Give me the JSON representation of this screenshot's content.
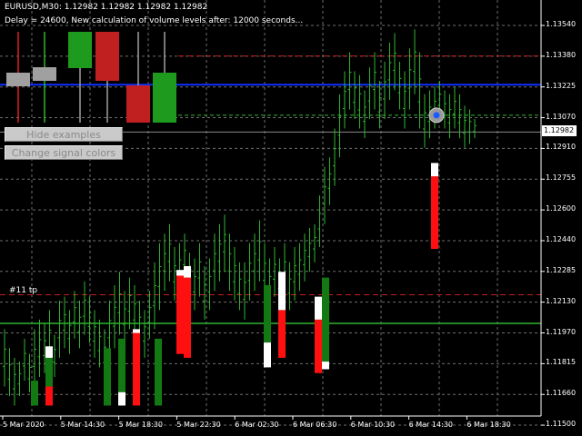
{
  "header": {
    "line1": "EURUSD,M30:  1.12982 1.12982 1.12982 1.12982",
    "line2": "Delay = 24600, New calculation of volume levels after: 12000 seconds..."
  },
  "buttons": {
    "hide_examples": "Hide examples",
    "change_signal_colors": "Change signal colors"
  },
  "current_price": "1.12982",
  "trade_label": "#11 tp",
  "price_axis": [
    "1.13540",
    "1.13380",
    "1.13225",
    "1.13070",
    "1.12910",
    "1.12755",
    "1.12600",
    "1.12440",
    "1.12285",
    "1.12130",
    "1.11970",
    "1.11815",
    "1.11660",
    "1.11500"
  ],
  "time_axis": [
    "5 Mar 2020",
    "5 Mar 14:30",
    "5 Mar 18:30",
    "5 Mar 22:30",
    "6 Mar 02:30",
    "6 Mar 06:30",
    "6 Mar 10:30",
    "6 Mar 14:30",
    "6 Mar 18:30"
  ],
  "colors": {
    "background": "#000000",
    "grid": "#6e6e6e",
    "bar": "#2fb52f",
    "buy_signal": "#137a13",
    "sell_signal": "#ff1010",
    "neutral": "#ffffff",
    "blue_line": "#1030ff",
    "tp_line": "#c81e1e",
    "green_level": "#2fb52f"
  },
  "chart_data": {
    "type": "bar",
    "symbol": "EURUSD",
    "timeframe": "M30",
    "ylim": [
      1.115,
      1.1354
    ],
    "levels": {
      "blue": 1.1323,
      "tp_top": 1.1338,
      "tp_bottom": 1.1213,
      "green_dashed": 1.1307,
      "green_solid": 1.1198,
      "current": 1.12982
    },
    "bars": [
      [
        1.1165,
        1.1195
      ],
      [
        1.116,
        1.1185
      ],
      [
        1.1155,
        1.118
      ],
      [
        1.116,
        1.1178
      ],
      [
        1.1168,
        1.119
      ],
      [
        1.1162,
        1.1182
      ],
      [
        1.1165,
        1.1195
      ],
      [
        1.117,
        1.12
      ],
      [
        1.1172,
        1.1198
      ],
      [
        1.1175,
        1.1205
      ],
      [
        1.117,
        1.1192
      ],
      [
        1.118,
        1.121
      ],
      [
        1.1185,
        1.1212
      ],
      [
        1.1182,
        1.1205
      ],
      [
        1.119,
        1.1215
      ],
      [
        1.1185,
        1.121
      ],
      [
        1.1192,
        1.122
      ],
      [
        1.1188,
        1.1212
      ],
      [
        1.118,
        1.1205
      ],
      [
        1.1175,
        1.12
      ],
      [
        1.1168,
        1.1195
      ],
      [
        1.118,
        1.121
      ],
      [
        1.1185,
        1.1218
      ],
      [
        1.1192,
        1.1225
      ],
      [
        1.1188,
        1.1215
      ],
      [
        1.1195,
        1.1222
      ],
      [
        1.119,
        1.1218
      ],
      [
        1.1185,
        1.121
      ],
      [
        1.118,
        1.1205
      ],
      [
        1.119,
        1.1215
      ],
      [
        1.1195,
        1.123
      ],
      [
        1.1205,
        1.124
      ],
      [
        1.1215,
        1.1245
      ],
      [
        1.122,
        1.125
      ],
      [
        1.121,
        1.1238
      ],
      [
        1.1215,
        1.124
      ],
      [
        1.122,
        1.1245
      ],
      [
        1.121,
        1.1235
      ],
      [
        1.1205,
        1.1232
      ],
      [
        1.1212,
        1.124
      ],
      [
        1.12,
        1.1228
      ],
      [
        1.1205,
        1.1232
      ],
      [
        1.1215,
        1.1245
      ],
      [
        1.122,
        1.125
      ],
      [
        1.1225,
        1.1255
      ],
      [
        1.1215,
        1.1245
      ],
      [
        1.121,
        1.1238
      ],
      [
        1.1205,
        1.123
      ],
      [
        1.12,
        1.123
      ],
      [
        1.121,
        1.124
      ],
      [
        1.1215,
        1.1245
      ],
      [
        1.122,
        1.1252
      ],
      [
        1.121,
        1.124
      ],
      [
        1.1205,
        1.1232
      ],
      [
        1.1212,
        1.1238
      ],
      [
        1.1208,
        1.1232
      ],
      [
        1.1212,
        1.124
      ],
      [
        1.1205,
        1.123
      ],
      [
        1.121,
        1.1238
      ],
      [
        1.1215,
        1.124
      ],
      [
        1.122,
        1.1245
      ],
      [
        1.1225,
        1.1248
      ],
      [
        1.123,
        1.125
      ],
      [
        1.1238,
        1.1265
      ],
      [
        1.125,
        1.128
      ],
      [
        1.126,
        1.1285
      ],
      [
        1.127,
        1.13
      ],
      [
        1.1285,
        1.1318
      ],
      [
        1.13,
        1.133
      ],
      [
        1.131,
        1.134
      ],
      [
        1.1305,
        1.133
      ],
      [
        1.13,
        1.1328
      ],
      [
        1.1295,
        1.132
      ],
      [
        1.1305,
        1.1332
      ],
      [
        1.131,
        1.134
      ],
      [
        1.13,
        1.1325
      ],
      [
        1.1305,
        1.1335
      ],
      [
        1.1315,
        1.1345
      ],
      [
        1.132,
        1.135
      ],
      [
        1.131,
        1.1335
      ],
      [
        1.13,
        1.133
      ],
      [
        1.131,
        1.1342
      ],
      [
        1.1318,
        1.1352
      ],
      [
        1.13,
        1.134
      ],
      [
        1.129,
        1.1318
      ],
      [
        1.1295,
        1.132
      ],
      [
        1.13,
        1.1322
      ],
      [
        1.1305,
        1.1325
      ],
      [
        1.13,
        1.132
      ],
      [
        1.1295,
        1.1318
      ],
      [
        1.13,
        1.1322
      ],
      [
        1.1295,
        1.1318
      ],
      [
        1.129,
        1.1312
      ],
      [
        1.1292,
        1.131
      ],
      [
        1.1295,
        1.1305
      ]
    ],
    "signals": [
      {
        "x": 38,
        "buy": [
          1.1155,
          1.1168
        ],
        "neutral": [],
        "sell": []
      },
      {
        "x": 54,
        "buy": [
          1.1165,
          1.118
        ],
        "neutral": [
          1.118,
          1.1186
        ],
        "sell": [
          1.1155,
          1.1165
        ]
      },
      {
        "x": 118,
        "buy": [
          1.1155,
          1.1185
        ],
        "neutral": [],
        "sell": []
      },
      {
        "x": 134,
        "buy": [
          1.1162,
          1.119
        ],
        "neutral": [
          1.1155,
          1.1162
        ],
        "sell": []
      },
      {
        "x": 150,
        "buy": [],
        "neutral": [
          1.1193,
          1.1195
        ],
        "sell": [
          1.1155,
          1.1193
        ]
      },
      {
        "x": 174,
        "buy": [
          1.1155,
          1.119
        ],
        "neutral": [],
        "sell": []
      },
      {
        "x": 198,
        "buy": [],
        "neutral": [
          1.1223,
          1.1226
        ],
        "sell": [
          1.1182,
          1.1223
        ]
      },
      {
        "x": 206,
        "buy": [],
        "neutral": [
          1.1222,
          1.1228
        ],
        "sell": [
          1.118,
          1.1222
        ]
      },
      {
        "x": 294,
        "buy": [
          1.1188,
          1.1218
        ],
        "neutral": [
          1.1175,
          1.1188
        ],
        "sell": []
      },
      {
        "x": 310,
        "buy": [],
        "neutral": [
          1.1205,
          1.1225
        ],
        "sell": [
          1.118,
          1.1205
        ]
      },
      {
        "x": 350,
        "buy": [],
        "neutral": [
          1.12,
          1.1212
        ],
        "sell": [
          1.1172,
          1.12
        ]
      },
      {
        "x": 358,
        "buy": [
          1.1178,
          1.1222
        ],
        "neutral": [
          1.1174,
          1.1178
        ],
        "sell": []
      },
      {
        "x": 478,
        "buy": [],
        "neutral": [
          1.1275,
          1.1282
        ],
        "sell": [
          1.1237,
          1.1275
        ]
      }
    ]
  }
}
